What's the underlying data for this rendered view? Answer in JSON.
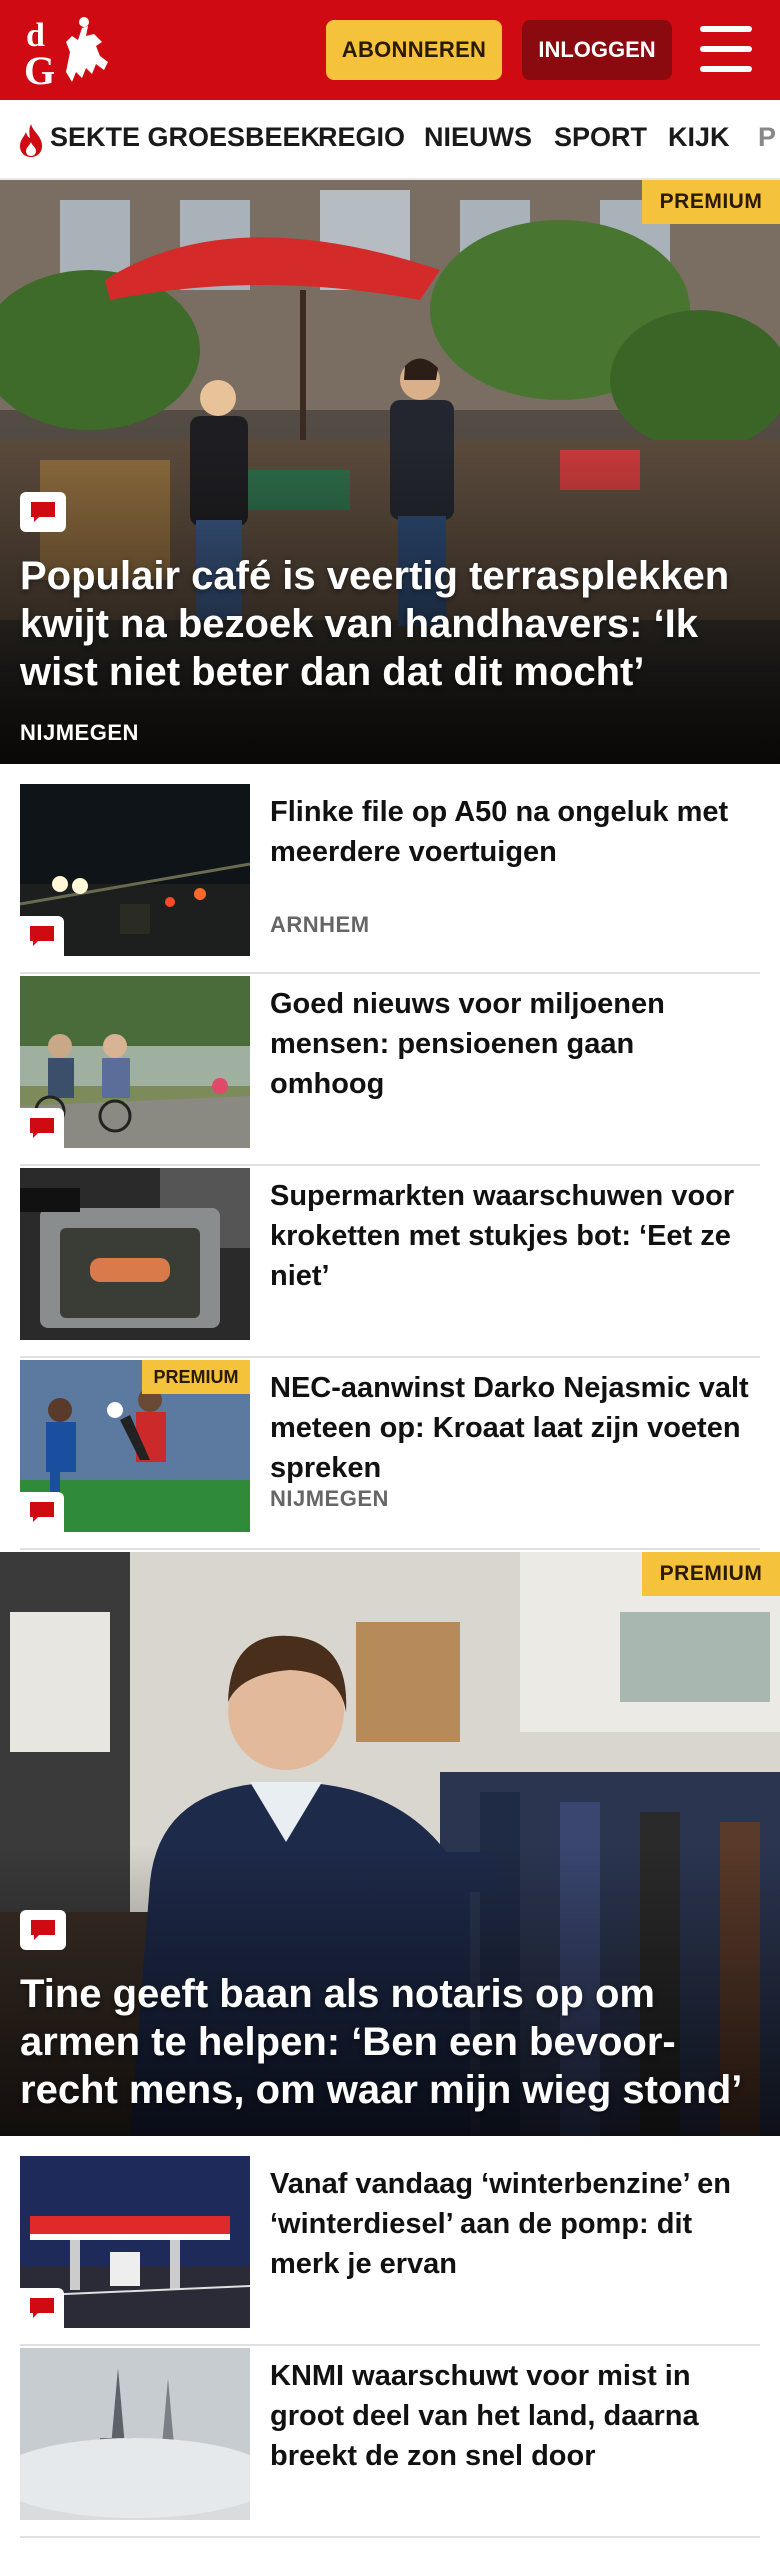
{
  "header": {
    "brand_initials": "dG",
    "subscribe_label": "ABONNEREN",
    "login_label": "INLOGGEN"
  },
  "nav": {
    "items": [
      "SEKTE GROESBEEK",
      "REGIO",
      "NIEUWS",
      "SPORT",
      "KIJK",
      "P"
    ]
  },
  "hero1": {
    "badge": "PREMIUM",
    "title": "Populair café is veertig terrasplekken kwijt na bezoek van handhavers: ‘Ik wist niet beter dan dat dit mocht’",
    "tag": "NIJMEGEN"
  },
  "list1": [
    {
      "title": "Flinke file op A50 na ongeluk met meerdere voertuigen",
      "tag": "ARNHEM",
      "premium": ""
    },
    {
      "title": "Goed nieuws voor miljoenen mensen: pensioenen gaan omhoog",
      "tag": "",
      "premium": ""
    },
    {
      "title": "Supermarkten waarschuwen voor kroketten met stukjes bot: ‘Eet ze niet’",
      "tag": "",
      "premium": ""
    },
    {
      "title": "NEC-aanwinst Darko Nejasmic valt meteen op: Kroaat laat zijn voeten spreken",
      "tag": "NIJMEGEN",
      "premium": "PREMIUM"
    }
  ],
  "hero2": {
    "badge": "PREMIUM",
    "title": "Tine geeft baan als notaris op om armen te helpen: ‘Ben een bevoor-recht mens, om waar mijn wieg stond’"
  },
  "list2": [
    {
      "title": "Vanaf vandaag ‘winterbenzine’ en ‘winterdiesel’ aan de pomp: dit merk je ervan"
    },
    {
      "title": "KNMI waarschuwt voor mist in groot deel van het land, daarna breekt de zon snel door"
    }
  ],
  "colors": {
    "brand_red": "#cf0a12",
    "premium_yellow": "#f5c33b",
    "login_dark_red": "#8a0a10"
  }
}
